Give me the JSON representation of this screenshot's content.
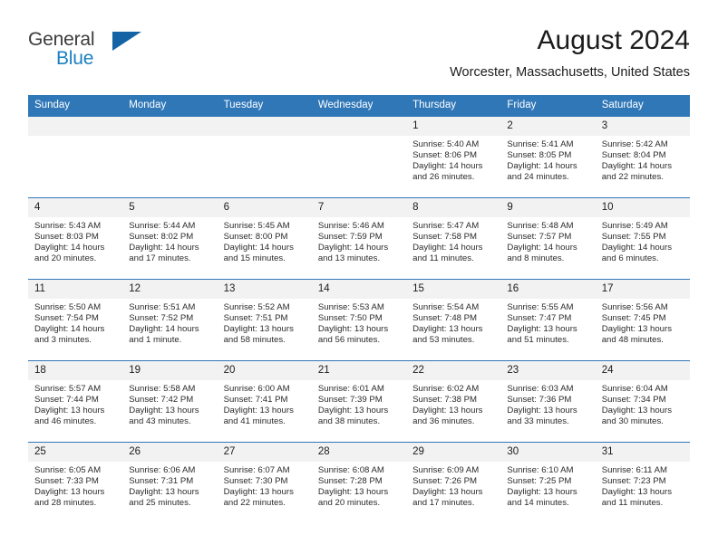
{
  "brand": {
    "line1": "General",
    "line2": "Blue",
    "triangle_color": "#1464a5",
    "blue_color": "#1a7fc1"
  },
  "header": {
    "title": "August 2024",
    "location": "Worcester, Massachusetts, United States"
  },
  "theme": {
    "header_band": "#3077b8",
    "daynum_band": "#f2f2f2",
    "text": "#1c1c1c"
  },
  "weekday_headers": [
    "Sunday",
    "Monday",
    "Tuesday",
    "Wednesday",
    "Thursday",
    "Friday",
    "Saturday"
  ],
  "labels": {
    "sunrise": "Sunrise:",
    "sunset": "Sunset:",
    "daylight": "Daylight:"
  },
  "weeks": [
    [
      {
        "day": "",
        "sunrise": "",
        "sunset": "",
        "daylight1": "",
        "daylight2": ""
      },
      {
        "day": "",
        "sunrise": "",
        "sunset": "",
        "daylight1": "",
        "daylight2": ""
      },
      {
        "day": "",
        "sunrise": "",
        "sunset": "",
        "daylight1": "",
        "daylight2": ""
      },
      {
        "day": "",
        "sunrise": "",
        "sunset": "",
        "daylight1": "",
        "daylight2": ""
      },
      {
        "day": "1",
        "sunrise": "Sunrise: 5:40 AM",
        "sunset": "Sunset: 8:06 PM",
        "daylight1": "Daylight: 14 hours",
        "daylight2": "and 26 minutes."
      },
      {
        "day": "2",
        "sunrise": "Sunrise: 5:41 AM",
        "sunset": "Sunset: 8:05 PM",
        "daylight1": "Daylight: 14 hours",
        "daylight2": "and 24 minutes."
      },
      {
        "day": "3",
        "sunrise": "Sunrise: 5:42 AM",
        "sunset": "Sunset: 8:04 PM",
        "daylight1": "Daylight: 14 hours",
        "daylight2": "and 22 minutes."
      }
    ],
    [
      {
        "day": "4",
        "sunrise": "Sunrise: 5:43 AM",
        "sunset": "Sunset: 8:03 PM",
        "daylight1": "Daylight: 14 hours",
        "daylight2": "and 20 minutes."
      },
      {
        "day": "5",
        "sunrise": "Sunrise: 5:44 AM",
        "sunset": "Sunset: 8:02 PM",
        "daylight1": "Daylight: 14 hours",
        "daylight2": "and 17 minutes."
      },
      {
        "day": "6",
        "sunrise": "Sunrise: 5:45 AM",
        "sunset": "Sunset: 8:00 PM",
        "daylight1": "Daylight: 14 hours",
        "daylight2": "and 15 minutes."
      },
      {
        "day": "7",
        "sunrise": "Sunrise: 5:46 AM",
        "sunset": "Sunset: 7:59 PM",
        "daylight1": "Daylight: 14 hours",
        "daylight2": "and 13 minutes."
      },
      {
        "day": "8",
        "sunrise": "Sunrise: 5:47 AM",
        "sunset": "Sunset: 7:58 PM",
        "daylight1": "Daylight: 14 hours",
        "daylight2": "and 11 minutes."
      },
      {
        "day": "9",
        "sunrise": "Sunrise: 5:48 AM",
        "sunset": "Sunset: 7:57 PM",
        "daylight1": "Daylight: 14 hours",
        "daylight2": "and 8 minutes."
      },
      {
        "day": "10",
        "sunrise": "Sunrise: 5:49 AM",
        "sunset": "Sunset: 7:55 PM",
        "daylight1": "Daylight: 14 hours",
        "daylight2": "and 6 minutes."
      }
    ],
    [
      {
        "day": "11",
        "sunrise": "Sunrise: 5:50 AM",
        "sunset": "Sunset: 7:54 PM",
        "daylight1": "Daylight: 14 hours",
        "daylight2": "and 3 minutes."
      },
      {
        "day": "12",
        "sunrise": "Sunrise: 5:51 AM",
        "sunset": "Sunset: 7:52 PM",
        "daylight1": "Daylight: 14 hours",
        "daylight2": "and 1 minute."
      },
      {
        "day": "13",
        "sunrise": "Sunrise: 5:52 AM",
        "sunset": "Sunset: 7:51 PM",
        "daylight1": "Daylight: 13 hours",
        "daylight2": "and 58 minutes."
      },
      {
        "day": "14",
        "sunrise": "Sunrise: 5:53 AM",
        "sunset": "Sunset: 7:50 PM",
        "daylight1": "Daylight: 13 hours",
        "daylight2": "and 56 minutes."
      },
      {
        "day": "15",
        "sunrise": "Sunrise: 5:54 AM",
        "sunset": "Sunset: 7:48 PM",
        "daylight1": "Daylight: 13 hours",
        "daylight2": "and 53 minutes."
      },
      {
        "day": "16",
        "sunrise": "Sunrise: 5:55 AM",
        "sunset": "Sunset: 7:47 PM",
        "daylight1": "Daylight: 13 hours",
        "daylight2": "and 51 minutes."
      },
      {
        "day": "17",
        "sunrise": "Sunrise: 5:56 AM",
        "sunset": "Sunset: 7:45 PM",
        "daylight1": "Daylight: 13 hours",
        "daylight2": "and 48 minutes."
      }
    ],
    [
      {
        "day": "18",
        "sunrise": "Sunrise: 5:57 AM",
        "sunset": "Sunset: 7:44 PM",
        "daylight1": "Daylight: 13 hours",
        "daylight2": "and 46 minutes."
      },
      {
        "day": "19",
        "sunrise": "Sunrise: 5:58 AM",
        "sunset": "Sunset: 7:42 PM",
        "daylight1": "Daylight: 13 hours",
        "daylight2": "and 43 minutes."
      },
      {
        "day": "20",
        "sunrise": "Sunrise: 6:00 AM",
        "sunset": "Sunset: 7:41 PM",
        "daylight1": "Daylight: 13 hours",
        "daylight2": "and 41 minutes."
      },
      {
        "day": "21",
        "sunrise": "Sunrise: 6:01 AM",
        "sunset": "Sunset: 7:39 PM",
        "daylight1": "Daylight: 13 hours",
        "daylight2": "and 38 minutes."
      },
      {
        "day": "22",
        "sunrise": "Sunrise: 6:02 AM",
        "sunset": "Sunset: 7:38 PM",
        "daylight1": "Daylight: 13 hours",
        "daylight2": "and 36 minutes."
      },
      {
        "day": "23",
        "sunrise": "Sunrise: 6:03 AM",
        "sunset": "Sunset: 7:36 PM",
        "daylight1": "Daylight: 13 hours",
        "daylight2": "and 33 minutes."
      },
      {
        "day": "24",
        "sunrise": "Sunrise: 6:04 AM",
        "sunset": "Sunset: 7:34 PM",
        "daylight1": "Daylight: 13 hours",
        "daylight2": "and 30 minutes."
      }
    ],
    [
      {
        "day": "25",
        "sunrise": "Sunrise: 6:05 AM",
        "sunset": "Sunset: 7:33 PM",
        "daylight1": "Daylight: 13 hours",
        "daylight2": "and 28 minutes."
      },
      {
        "day": "26",
        "sunrise": "Sunrise: 6:06 AM",
        "sunset": "Sunset: 7:31 PM",
        "daylight1": "Daylight: 13 hours",
        "daylight2": "and 25 minutes."
      },
      {
        "day": "27",
        "sunrise": "Sunrise: 6:07 AM",
        "sunset": "Sunset: 7:30 PM",
        "daylight1": "Daylight: 13 hours",
        "daylight2": "and 22 minutes."
      },
      {
        "day": "28",
        "sunrise": "Sunrise: 6:08 AM",
        "sunset": "Sunset: 7:28 PM",
        "daylight1": "Daylight: 13 hours",
        "daylight2": "and 20 minutes."
      },
      {
        "day": "29",
        "sunrise": "Sunrise: 6:09 AM",
        "sunset": "Sunset: 7:26 PM",
        "daylight1": "Daylight: 13 hours",
        "daylight2": "and 17 minutes."
      },
      {
        "day": "30",
        "sunrise": "Sunrise: 6:10 AM",
        "sunset": "Sunset: 7:25 PM",
        "daylight1": "Daylight: 13 hours",
        "daylight2": "and 14 minutes."
      },
      {
        "day": "31",
        "sunrise": "Sunrise: 6:11 AM",
        "sunset": "Sunset: 7:23 PM",
        "daylight1": "Daylight: 13 hours",
        "daylight2": "and 11 minutes."
      }
    ]
  ]
}
